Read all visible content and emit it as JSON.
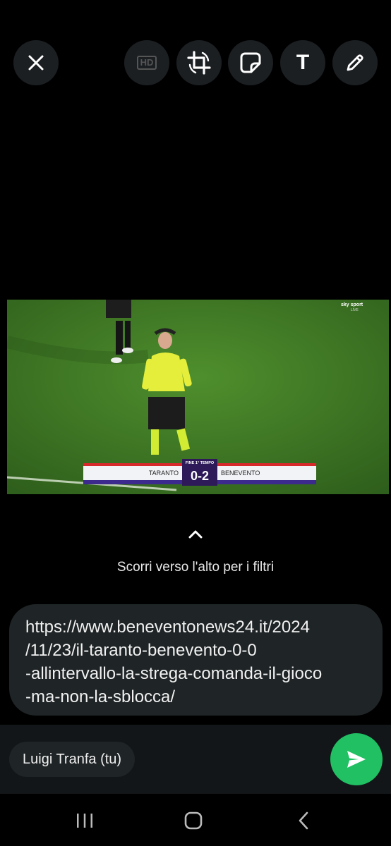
{
  "toolbar": {
    "close_icon": "close-icon",
    "hd_label": "HD",
    "crop_rotate_icon": "crop-rotate-icon",
    "sticker_icon": "sticker-icon",
    "text_label": "T",
    "draw_icon": "pencil-icon"
  },
  "media": {
    "scoreboard": {
      "period": "FINE 1° TEMPO",
      "home_team": "TARANTO",
      "score": "0-2",
      "away_team": "BENEVENTO"
    },
    "broadcaster_logo": "sky sport LIVE",
    "colors": {
      "pitch": "#3f7a26",
      "scoreboard_bg": "#2e1a59"
    }
  },
  "filters_hint": {
    "icon": "chevron-up-icon",
    "text": "Scorri verso l'alto per i filtri"
  },
  "caption": {
    "text": "https://www.beneventonews24.it/2024\n/11/23/il-taranto-benevento-0-0\n-allintervallo-la-strega-comanda-il-gioco\n-ma-non-la-sblocca/"
  },
  "recipient": {
    "label": "Luigi Tranfa (tu)"
  },
  "send": {
    "icon": "send-icon",
    "color": "#21c063"
  },
  "navigation": {
    "recents_icon": "recents-icon",
    "home_icon": "home-icon",
    "back_icon": "back-icon"
  }
}
